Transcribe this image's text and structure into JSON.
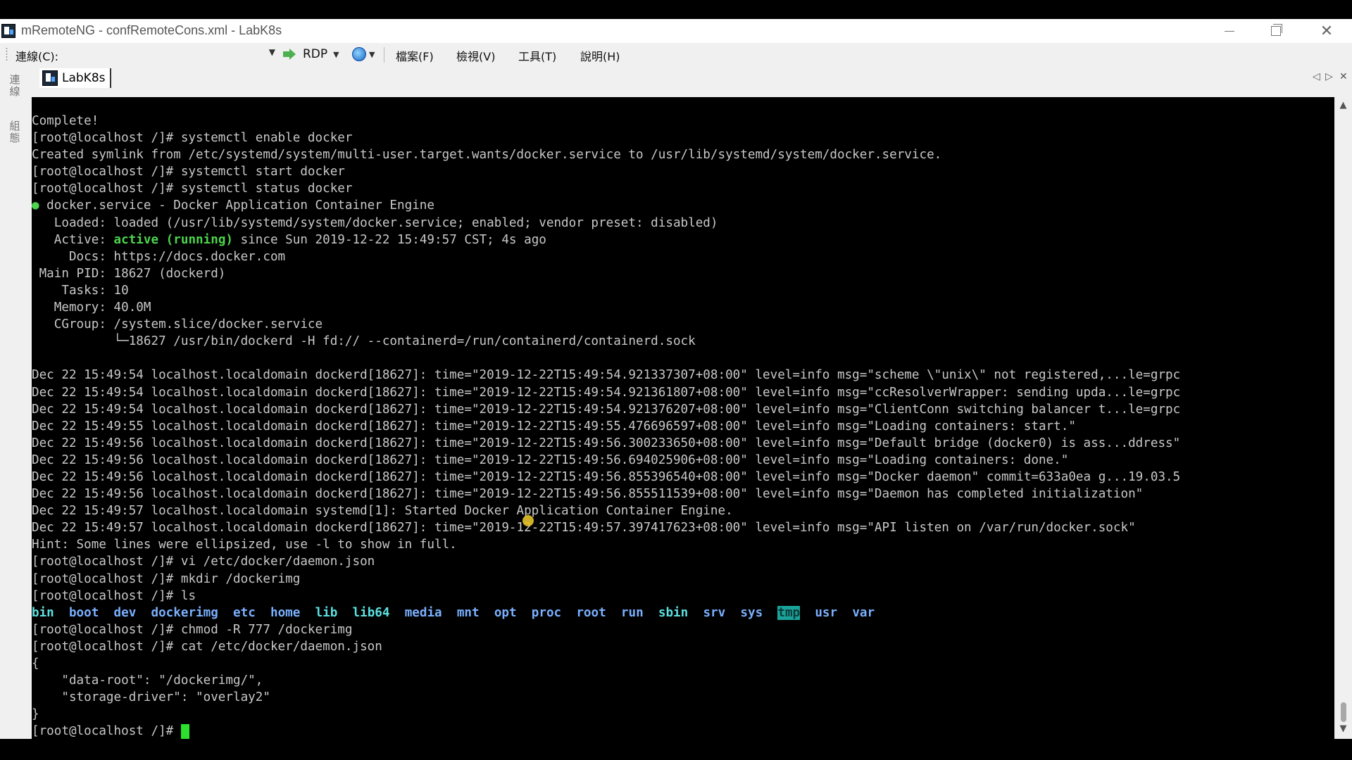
{
  "window": {
    "title": "mRemoteNG - confRemoteCons.xml - LabK8s",
    "min_glyph": "",
    "max_glyph": "",
    "close_glyph": "✕"
  },
  "menubar": {
    "connect_label": "連線(C):",
    "connect_value": "",
    "rdp_label": "RDP",
    "items": [
      "檔案(F)",
      "檢視(V)",
      "工具(T)",
      "說明(H)"
    ]
  },
  "sidebar": {
    "panel1": "連線",
    "panel2": "組態"
  },
  "tabs": {
    "active": "LabK8s",
    "prev_glyph": "◁",
    "next_glyph": "▷",
    "close_glyph": "✕"
  },
  "terminal": {
    "lines": [
      "Complete!",
      "[root@localhost /]# systemctl enable docker",
      "Created symlink from /etc/systemd/system/multi-user.target.wants/docker.service to /usr/lib/systemd/system/docker.service.",
      "[root@localhost /]# systemctl start docker",
      "[root@localhost /]# systemctl status docker",
      "● docker.service - Docker Application Container Engine",
      "   Loaded: loaded (/usr/lib/systemd/system/docker.service; enabled; vendor preset: disabled)",
      "   Active: |active (running)| since Sun 2019-12-22 15:49:57 CST; 4s ago",
      "     Docs: https://docs.docker.com",
      " Main PID: 18627 (dockerd)",
      "    Tasks: 10",
      "   Memory: 40.0M",
      "   CGroup: /system.slice/docker.service",
      "           └─18627 /usr/bin/dockerd -H fd:// --containerd=/run/containerd/containerd.sock",
      "",
      "Dec 22 15:49:54 localhost.localdomain dockerd[18627]: time=\"2019-12-22T15:49:54.921337307+08:00\" level=info msg=\"scheme \\\"unix\\\" not registered,...le=grpc",
      "Dec 22 15:49:54 localhost.localdomain dockerd[18627]: time=\"2019-12-22T15:49:54.921361807+08:00\" level=info msg=\"ccResolverWrapper: sending upda...le=grpc",
      "Dec 22 15:49:54 localhost.localdomain dockerd[18627]: time=\"2019-12-22T15:49:54.921376207+08:00\" level=info msg=\"ClientConn switching balancer t...le=grpc",
      "Dec 22 15:49:55 localhost.localdomain dockerd[18627]: time=\"2019-12-22T15:49:55.476696597+08:00\" level=info msg=\"Loading containers: start.\"",
      "Dec 22 15:49:56 localhost.localdomain dockerd[18627]: time=\"2019-12-22T15:49:56.300233650+08:00\" level=info msg=\"Default bridge (docker0) is ass...ddress\"",
      "Dec 22 15:49:56 localhost.localdomain dockerd[18627]: time=\"2019-12-22T15:49:56.694025906+08:00\" level=info msg=\"Loading containers: done.\"",
      "Dec 22 15:49:56 localhost.localdomain dockerd[18627]: time=\"2019-12-22T15:49:56.855396540+08:00\" level=info msg=\"Docker daemon\" commit=633a0ea g...19.03.5",
      "Dec 22 15:49:56 localhost.localdomain dockerd[18627]: time=\"2019-12-22T15:49:56.855511539+08:00\" level=info msg=\"Daemon has completed initialization\"",
      "Dec 22 15:49:57 localhost.localdomain systemd[1]: Started Docker Application Container Engine.",
      "Dec 22 15:49:57 localhost.localdomain dockerd[18627]: time=\"2019-12-22T15:49:57.397417623+08:00\" level=info msg=\"API listen on /var/run/docker.sock\"",
      "Hint: Some lines were ellipsized, use -l to show in full.",
      "[root@localhost /]# vi /etc/docker/daemon.json",
      "[root@localhost /]# mkdir /dockerimg",
      "[root@localhost /]# ls",
      "@LS@",
      "[root@localhost /]# chmod -R 777 /dockerimg",
      "[root@localhost /]# cat /etc/docker/daemon.json",
      "{",
      "    \"data-root\": \"/dockerimg/\",",
      "    \"storage-driver\": \"overlay2\"",
      "}",
      "[root@localhost /]# @CURSOR@"
    ],
    "ls_entries": [
      {
        "name": "bin",
        "style": "cyan-b"
      },
      {
        "name": "boot",
        "style": "blue-b"
      },
      {
        "name": "dev",
        "style": "blue-b"
      },
      {
        "name": "dockerimg",
        "style": "blue-b"
      },
      {
        "name": "etc",
        "style": "blue-b"
      },
      {
        "name": "home",
        "style": "blue-b"
      },
      {
        "name": "lib",
        "style": "cyan-b"
      },
      {
        "name": "lib64",
        "style": "cyan-b"
      },
      {
        "name": "media",
        "style": "blue-b"
      },
      {
        "name": "mnt",
        "style": "blue-b"
      },
      {
        "name": "opt",
        "style": "blue-b"
      },
      {
        "name": "proc",
        "style": "blue-b"
      },
      {
        "name": "root",
        "style": "blue-b"
      },
      {
        "name": "run",
        "style": "blue-b"
      },
      {
        "name": "sbin",
        "style": "cyan-b"
      },
      {
        "name": "srv",
        "style": "blue-b"
      },
      {
        "name": "sys",
        "style": "blue-b"
      },
      {
        "name": "tmp",
        "style": "tmp-hl"
      },
      {
        "name": "usr",
        "style": "blue-b"
      },
      {
        "name": "var",
        "style": "blue-b"
      }
    ],
    "colors": {
      "background": "#000000",
      "foreground": "#c8c8c8",
      "active_green": "#4cd44c",
      "cursor": "#2ee02e"
    }
  },
  "scrollbar": {
    "up_glyph": "▲",
    "down_glyph": "▼"
  }
}
